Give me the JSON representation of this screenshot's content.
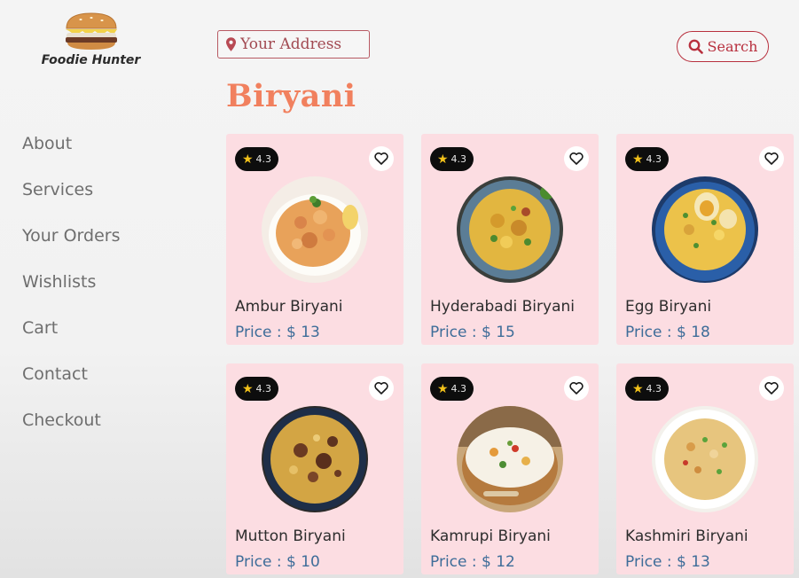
{
  "brand": {
    "name": "Foodie Hunter",
    "logo_icon": "burger-icon"
  },
  "nav": {
    "items": [
      {
        "label": "About"
      },
      {
        "label": "Services"
      },
      {
        "label": "Your Orders"
      },
      {
        "label": "Wishlists"
      },
      {
        "label": "Cart"
      },
      {
        "label": "Contact"
      },
      {
        "label": "Checkout"
      }
    ]
  },
  "header": {
    "address_placeholder": "Your Address",
    "search_label": "Search",
    "address_icon": "location-pin-icon",
    "search_icon": "search-icon"
  },
  "category": {
    "title": "Biryani"
  },
  "price_prefix": "Price : $",
  "colors": {
    "accent": "#f1805e",
    "card_bg": "#fcdde2",
    "price_text": "#3e6d99",
    "button_border": "#b8303e"
  },
  "dishes": [
    {
      "name": "Ambur Biryani",
      "price": "13",
      "rating": "4.3",
      "icon": "ambur-biryani-image"
    },
    {
      "name": "Hyderabadi Biryani",
      "price": "15",
      "rating": "4.3",
      "icon": "hyderabadi-biryani-image"
    },
    {
      "name": "Egg Biryani",
      "price": "18",
      "rating": "4.3",
      "icon": "egg-biryani-image"
    },
    {
      "name": "Mutton Biryani",
      "price": "10",
      "rating": "4.3",
      "icon": "mutton-biryani-image"
    },
    {
      "name": "Kamrupi Biryani",
      "price": "12",
      "rating": "4.3",
      "icon": "kamrupi-biryani-image"
    },
    {
      "name": "Kashmiri Biryani",
      "price": "13",
      "rating": "4.3",
      "icon": "kashmiri-biryani-image"
    }
  ]
}
